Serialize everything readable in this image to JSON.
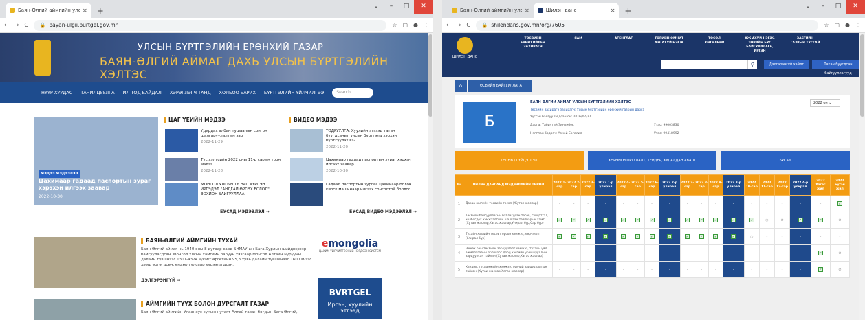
{
  "w1": {
    "tab_title": "Баян-Өлгий аймгийн улсын бүр",
    "url": "bayan-ulgii.burtgel.gov.mn",
    "banner_line1": "УЛСЫН БҮРТГЭЛИЙН ЕРӨНХИЙ ГАЗАР",
    "banner_line2": "БАЯН-ӨЛГИЙ АЙМАГ ДАХЬ УЛСЫН БҮРТГЭЛИЙН ХЭЛТЭС",
    "nav": [
      "НҮҮР ХУУДАС",
      "ТАНИЛЦУУЛГА",
      "ИЛ ТОД БАЙДАЛ",
      "ХЭРЭГЛЭГЧ ТАНД",
      "ХОЛБОО БАРИХ",
      "БҮРТГЭЛИЙН ҮЙЛЧИЛГЭЭ"
    ],
    "search_placeholder": "Search...",
    "featured": {
      "tag": "МЭДЭЭ МЭДЭЭЛЭЛ",
      "title": "Цахимаар гадаад паспортын зураг хэрэхэн илгээх заавар",
      "date": "2022-10-30"
    },
    "news_heading": "ЦАГ ҮЕИЙН МЭДЭЭ",
    "video_heading": "ВИДЕО МЭДЭЭ",
    "news": [
      {
        "title": "Үдирдах албан тушаалын сонгон шалгаруулалтын зар",
        "date": "2022-11-29"
      },
      {
        "title": "Тус хэлтсийн 2022 оны 11-р сарын тоон мэдээ",
        "date": "2022-11-28"
      },
      {
        "title": "МОНГОЛ УЛСЫН 16 НАС ХҮРСЭН ИРГЭДЭД \"АНДГАЙ ӨРГӨХ ЁСЛОЛ\" ЗОХИОН БАЙГУУЛЛАА",
        "date": ""
      }
    ],
    "videos": [
      {
        "title": "ТОДРУУЛГА: Хуулийн этгээд татан буугдсаныг улсын бүртгэлд хэрхэн бүртгүүлэх вэ?",
        "date": "2022-11-20"
      },
      {
        "title": "Цахимаар гадаад паспортын зураг хэрхэн илгээх заавар",
        "date": "2022-10-30"
      },
      {
        "title": "Гадаад паспортын зургаа цахимаар болон киоск машинаар илгээх сонголтой боллоо",
        "date": ""
      }
    ],
    "more_news": "БУСАД МЭДЭЭЛЭЛ →",
    "more_video": "БУСАД ВИДЕО МЭДЭЭЛЭЛ →",
    "about_title": "БАЯН-ӨЛГИЙ АЙМГИЙН ТУХАЙ",
    "about_text": "Баян-Өлгий аймаг нь 1940 оны 8 дугаар сард БНМАУ-ын Бага Хурлын шийдвэрээр байгуулагдсан. Монгол Улсын хамгийн баруун хязгаар Монгол Алтайн нурууны далайн түвшнээс 1301-4374 м/км/т өргөтийн 95,3 хувь далайн түвшинээс 1600 м-ээс дээш өргөгдсөн, өндөр уулсаар хүрээлэгдсэн.",
    "about_more": "ДЭЛГЭРЭНГҮЙ →",
    "history_title": "АЙМГИЙН ТҮҮХ БОЛОН ДУРСГАЛТ ГАЗАР",
    "history_text": "Баян-Өлгий аймгийн Улаанхус сумын нутагт Алтай таван богдын Бага Өлгий,",
    "emongolia": "mongolia",
    "emongolia_sub": "ЦАХИМ ҮЙЛЧИЛГЭЭНИЙ НЭГДСЭН СИСТЕМ",
    "burtgel": "BVRTGEL",
    "burtgel_sub": "Иргэн, хуулийн этгээд"
  },
  "w2": {
    "tab1_title": "Баян-Өлгий аймгийн улсын бү",
    "tab2_title": "Шилэн данс",
    "url": "shilendans.gov.mn/org/7605",
    "logo_text": "ШИЛЭН ДАНС",
    "menu": [
      "ТӨСВИЙН ЕРӨНХИЙЛЕН ЗАХИРАГЧ",
      "ЯАМ",
      "АГЕНТЛАГ",
      "ТӨРИЙН ӨМЧИТ АЖ АХУЙ НЭГЖ",
      "ТӨСӨЛ ХӨТӨЛБӨР",
      "АЖ АХУЙ НЭГЖ, ТӨРИЙН БУС БАЙГУУЛЛАГА, ИРГЭН",
      "ЗАСГИЙН ГАЗРЫН ТУСГАЙ"
    ],
    "btn_advanced": "Дэлгэрэнгүй хайлт",
    "btn_budget": "Татан буугдсан байгууллагууд",
    "crumb": "ТӨСВИЙН БАЙГУУЛЛАГА",
    "org_letter": "Б",
    "org_name": "БАЯН-ӨЛГИЙ АЙМАГ УЛСЫН БҮРТГЭЛИЙН ХЭЛТЭС",
    "org_l1": "Төсвийн захирагч захирагч: Улсын бүртгэлийн ерөнхий газрын дарга",
    "org_l2": "Үүсгэн байгуулагдсан он: 2016/07/27",
    "org_l3": "Дарга: Табинтай Зинаибек",
    "org_l3b": "Утас: 99003830",
    "org_l4": "Нягтлан бодогч: Азией Ергалия",
    "org_l4b": "Утас: 99418992",
    "year_select": "2022 он",
    "tabs": [
      "ТӨСӨВ / ГҮЙЦЭТГЭЛ",
      "ХӨРӨНГӨ ОРУУЛАЛТ, ТЕНДЕР, ХУДАЛДАН АВАЛТ",
      "БУСАД"
    ],
    "col_no": "№",
    "col_name": "ШИЛЭН ДАНСАНД МЭДЭЭЛЛИЙН ТӨРӨЛ",
    "cols": [
      "2022 1-сар",
      "2022 2-сар",
      "2022 3-сар",
      "2022 1-р улирал",
      "2022 4-сар",
      "2022 5-сар",
      "2022 6-сар",
      "2022 2-р улирал",
      "2022 7-сар",
      "2022 8-сар",
      "2022 9-сар",
      "2022 3-р улирал",
      "2022 10-сар",
      "2022 11-сар",
      "2022 12-сар",
      "2022 4-р улирал",
      "2022 Хагас жил",
      "2022 Бүтэн жил"
    ],
    "rows": [
      {
        "no": "1",
        "name": "Дараа жилийн төсвийн төсөл (Жутаи жаслар)",
        "cells": [
          "-",
          "-",
          "-",
          "-",
          "-",
          "-",
          "-",
          "-",
          "-",
          "-",
          "-",
          "-",
          "-",
          "-",
          "-",
          "-",
          "-",
          "✓"
        ]
      },
      {
        "no": "2",
        "name": "Төсвийн байгууллагын батлагдсан төсөв, гүйцэтгэл, холбогдох хэмжээлтийн шалгаан тайлбарын хамт (Хутаи жаслар,Хагас жаслар,Улирал бүр,Сар бүр)",
        "cells": [
          "✓",
          "✓",
          "✓",
          "✓",
          "✓",
          "✓",
          "✓",
          "✓",
          "✓",
          "✓",
          "✓",
          "✓",
          "✓",
          "○",
          "⊘",
          "✓",
          "✓",
          "⊘"
        ]
      },
      {
        "no": "3",
        "name": "Тухайн жилийн төсөвт орсон хэмжээ, өөрчлөлт (Улирал бүр)",
        "cells": [
          "✓",
          "✓",
          "✓",
          "✓",
          "✓",
          "✓",
          "✓",
          "✓",
          "✓",
          "✓",
          "✓",
          "✓",
          "○",
          "-",
          "-",
          "-",
          "-",
          "-"
        ]
      },
      {
        "no": "4",
        "name": "Өмнөх оны төсвийн зарцуулалт хэмжээ, тухайн үйл ажиллагааны орлогоос доод хэсгийн урамшууллын зарцуулсан тайлан (Хутаи жаслар,Хагас жаслар)",
        "cells": [
          "-",
          "-",
          "-",
          "-",
          "-",
          "-",
          "-",
          "-",
          "-",
          "-",
          "-",
          "-",
          "-",
          "-",
          "-",
          "-",
          "✓",
          "⊘"
        ]
      },
      {
        "no": "5",
        "name": "Хандив, тусламжийн хэмжээ, түүний зарцуулалтын тайлан (Хутаи жаслар,Хагас жаслар)",
        "cells": [
          "-",
          "-",
          "-",
          "-",
          "-",
          "-",
          "-",
          "-",
          "-",
          "-",
          "-",
          "-",
          "-",
          "-",
          "-",
          "-",
          "✓",
          "⊘"
        ]
      }
    ]
  },
  "colors": {
    "accent_orange": "#f39c12",
    "navy": "#1b3568",
    "blue": "#1e4c8e"
  }
}
